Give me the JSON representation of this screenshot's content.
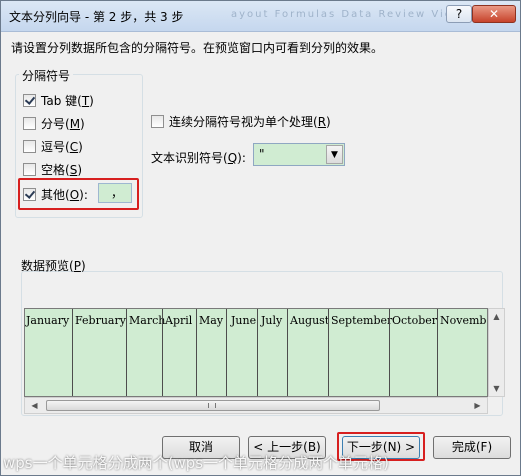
{
  "window": {
    "title": "文本分列向导 - 第 2 步，共 3 步",
    "help_label": "?",
    "close_label": "✕",
    "background_ghost": "ayout   Formulas   Data   Review   View"
  },
  "instruction": "请设置分列数据所包含的分隔符号。在预览窗口内可看到分列的效果。",
  "delimiters": {
    "group_title": "分隔符号",
    "tab": {
      "label": "Tab 键(",
      "key": "T",
      "suffix": ")",
      "checked": true
    },
    "semicolon": {
      "label": "分号(",
      "key": "M",
      "suffix": ")",
      "checked": false
    },
    "comma": {
      "label": "逗号(",
      "key": "C",
      "suffix": ")",
      "checked": false
    },
    "space": {
      "label": "空格(",
      "key": "S",
      "suffix": ")",
      "checked": false
    },
    "other": {
      "label": "其他(",
      "key": "O",
      "suffix": "):",
      "checked": true,
      "value": "，"
    }
  },
  "consecutive": {
    "label": "连续分隔符号视为单个处理(",
    "key": "R",
    "suffix": ")",
    "checked": false
  },
  "text_qualifier": {
    "label": "文本识别符号(",
    "key": "Q",
    "suffix": "):",
    "value": "\""
  },
  "preview": {
    "label": "数据预览(",
    "key": "P",
    "suffix": ")",
    "columns": [
      "January",
      "February",
      "March",
      "April",
      "May",
      "June",
      "July",
      "August",
      "September",
      "October",
      "November"
    ]
  },
  "buttons": {
    "cancel": "取消",
    "back": "< 上一步(B)",
    "next": "下一步(N) >",
    "finish": "完成(F)"
  },
  "watermark": "wps一个单元格分成两个(wps一个单元格分成两个单元格)"
}
